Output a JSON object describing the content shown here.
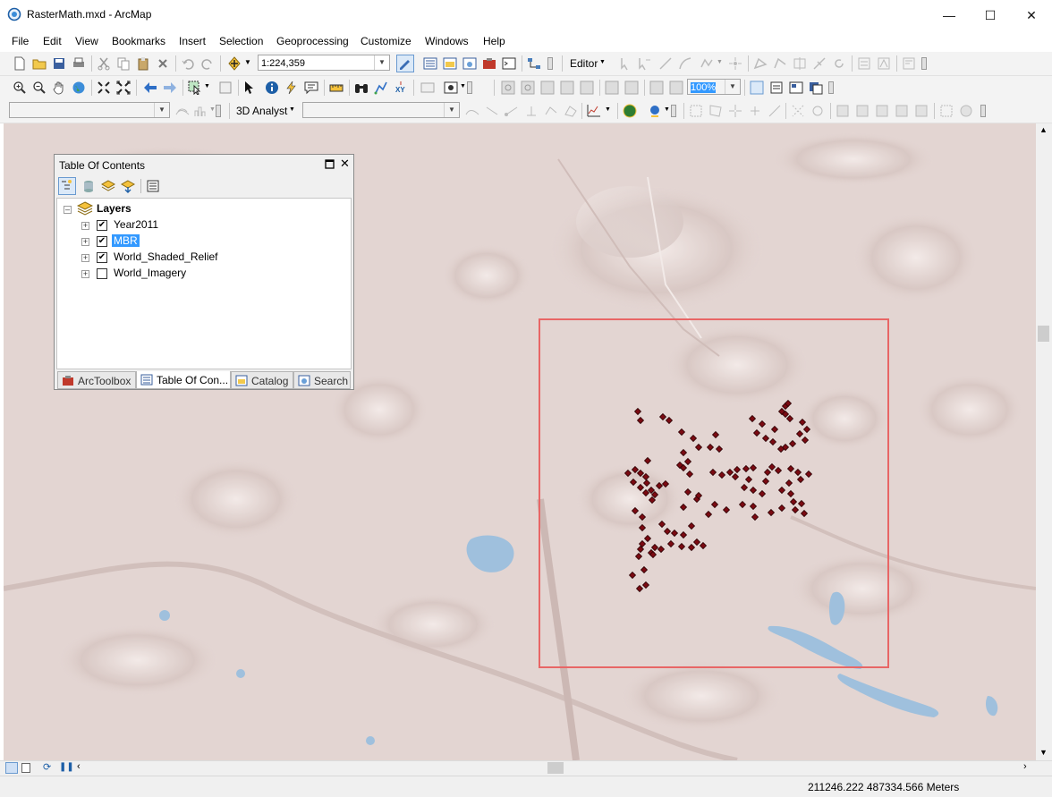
{
  "window": {
    "title": "RasterMath.mxd - ArcMap",
    "minimize": "—",
    "maximize": "☐",
    "close": "✕"
  },
  "menu": [
    "File",
    "Edit",
    "View",
    "Bookmarks",
    "Insert",
    "Selection",
    "Geoprocessing",
    "Customize",
    "Windows",
    "Help"
  ],
  "toolbar": {
    "scale": "1:224,359",
    "editor": "Editor",
    "zoom_percent": "100%",
    "analyst": "3D Analyst",
    "layer_combo": "",
    "surface_combo": ""
  },
  "toc": {
    "title": "Table Of Contents",
    "root": "Layers",
    "layers": [
      {
        "name": "Year2011",
        "checked": true,
        "selected": false
      },
      {
        "name": "MBR",
        "checked": true,
        "selected": true
      },
      {
        "name": "World_Shaded_Relief",
        "checked": true,
        "selected": false
      },
      {
        "name": "World_Imagery",
        "checked": false,
        "selected": false
      }
    ],
    "tabs": [
      "ArcToolbox",
      "Table Of Con...",
      "Catalog",
      "Search"
    ]
  },
  "status": {
    "coords": "211246.222  487334.566 Meters"
  },
  "colors": {
    "map_bg": "#e3d5d2",
    "water": "#9fc0dd",
    "mbr": "#e86666",
    "points": "#7a0a12",
    "selection": "#3399ff"
  }
}
